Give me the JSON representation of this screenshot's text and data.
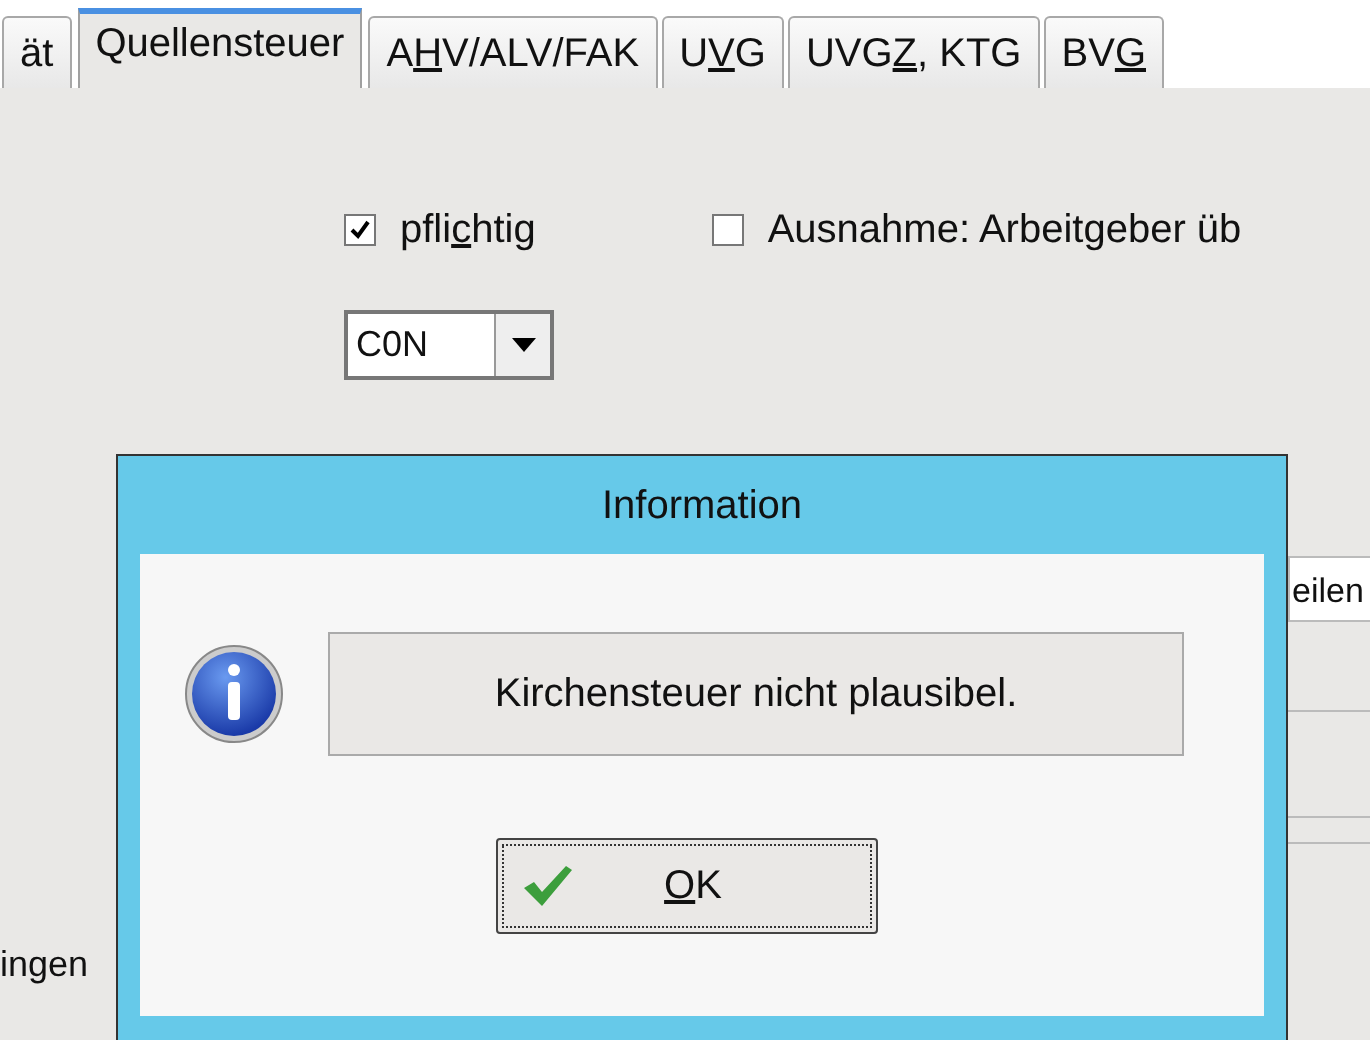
{
  "tabs": [
    {
      "label": [
        {
          "text": "ät",
          "underlined": false
        }
      ],
      "selected": false
    },
    {
      "label": [
        {
          "text": "Quellensteuer",
          "underlined": false
        }
      ],
      "selected": true
    },
    {
      "label": [
        {
          "text": "A",
          "underlined": false
        },
        {
          "text": "H",
          "underlined": true
        },
        {
          "text": "V/ALV/FAK",
          "underlined": false
        }
      ],
      "selected": false
    },
    {
      "label": [
        {
          "text": "U",
          "underlined": false
        },
        {
          "text": "V",
          "underlined": true
        },
        {
          "text": "G",
          "underlined": false
        }
      ],
      "selected": false
    },
    {
      "label": [
        {
          "text": "UVG",
          "underlined": false
        },
        {
          "text": "Z",
          "underlined": true
        },
        {
          "text": ", KTG",
          "underlined": false
        }
      ],
      "selected": false
    },
    {
      "label": [
        {
          "text": "BV",
          "underlined": false
        },
        {
          "text": "G",
          "underlined": true
        }
      ],
      "selected": false
    }
  ],
  "form": {
    "checkboxes": [
      {
        "label": [
          {
            "text": "pfli",
            "underlined": false
          },
          {
            "text": "c",
            "underlined": true
          },
          {
            "text": "htig",
            "underlined": false
          }
        ],
        "checked": true
      },
      {
        "label": [
          {
            "text": "Ausnahme: Arbeitgeber üb",
            "underlined": false
          }
        ],
        "checked": false
      }
    ],
    "code_dropdown": {
      "value": "C0N"
    },
    "field_text": "eilen",
    "side_label": "ingen"
  },
  "dialog": {
    "title": "Information",
    "message": "Kirchensteuer nicht plausibel.",
    "button": {
      "label": [
        {
          "text": "O",
          "underlined": true
        },
        {
          "text": "K",
          "underlined": false
        }
      ]
    }
  }
}
